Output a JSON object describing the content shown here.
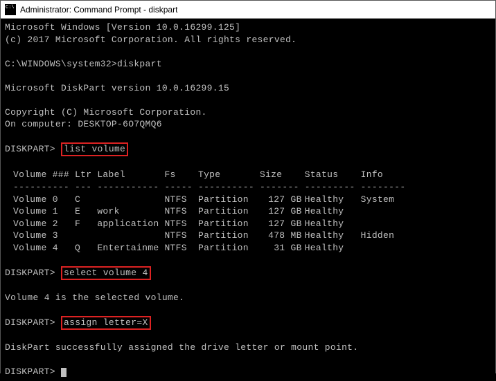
{
  "window": {
    "title": "Administrator: Command Prompt - diskpart"
  },
  "lines": {
    "winver": "Microsoft Windows [Version 10.0.16299.125]",
    "copyright1": "(c) 2017 Microsoft Corporation. All rights reserved.",
    "prompt1": "C:\\WINDOWS\\system32>",
    "cmd1": "diskpart",
    "dpver": "Microsoft DiskPart version 10.0.16299.15",
    "copyright2": "Copyright (C) Microsoft Corporation.",
    "oncomp": "On computer: DESKTOP-6O7QMQ6",
    "dp": "DISKPART>",
    "listvol": "list volume",
    "selvol": "select volume 4",
    "selmsg": "Volume 4 is the selected volume.",
    "assign": "assign letter=X",
    "assignmsg": "DiskPart successfully assigned the drive letter or mount point."
  },
  "table": {
    "headers": [
      "Volume ###",
      "Ltr",
      "Label",
      "Fs",
      "Type",
      "Size",
      "Status",
      "Info"
    ],
    "dashes": [
      "----------",
      "---",
      "-----------",
      "-----",
      "----------",
      "-------",
      "---------",
      "--------"
    ],
    "rows": [
      {
        "vol": "Volume 0",
        "ltr": "C",
        "label": "",
        "fs": "NTFS",
        "type": "Partition",
        "size": "127 GB",
        "status": "Healthy",
        "info": "System"
      },
      {
        "vol": "Volume 1",
        "ltr": "E",
        "label": "work",
        "fs": "NTFS",
        "type": "Partition",
        "size": "127 GB",
        "status": "Healthy",
        "info": ""
      },
      {
        "vol": "Volume 2",
        "ltr": "F",
        "label": "application",
        "fs": "NTFS",
        "type": "Partition",
        "size": "127 GB",
        "status": "Healthy",
        "info": ""
      },
      {
        "vol": "Volume 3",
        "ltr": "",
        "label": "",
        "fs": "NTFS",
        "type": "Partition",
        "size": "478 MB",
        "status": "Healthy",
        "info": "Hidden"
      },
      {
        "vol": "Volume 4",
        "ltr": "Q",
        "label": "Entertainme",
        "fs": "NTFS",
        "type": "Partition",
        "size": "31 GB",
        "status": "Healthy",
        "info": ""
      }
    ]
  }
}
